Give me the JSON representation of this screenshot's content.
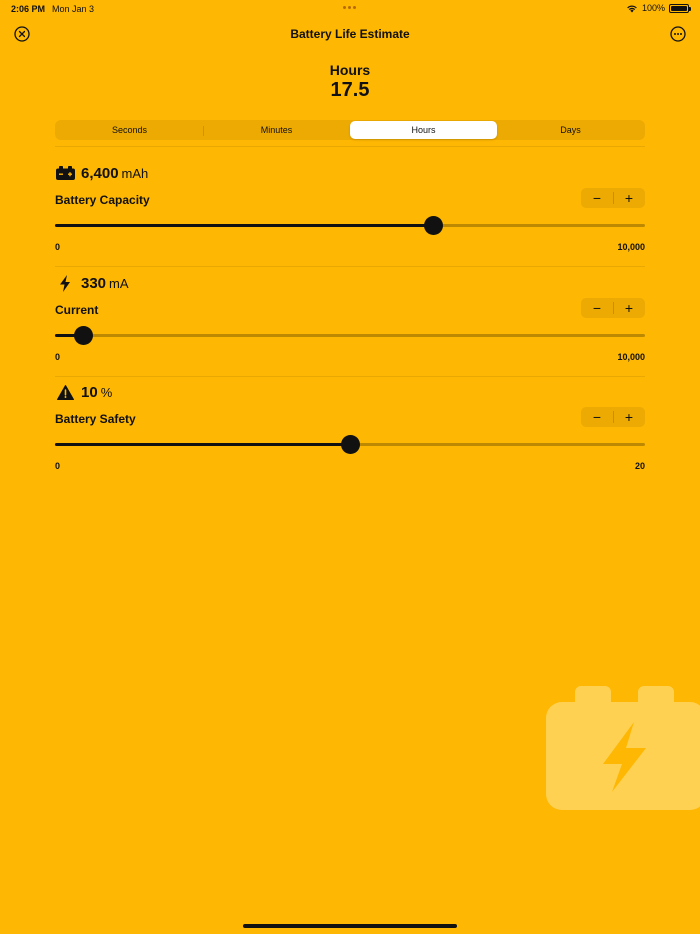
{
  "status_bar": {
    "time": "2:06 PM",
    "date": "Mon Jan 3",
    "battery_percent": "100%"
  },
  "nav": {
    "title": "Battery Life Estimate",
    "close_icon": "close-circle-icon",
    "more_icon": "ellipsis-circle-icon"
  },
  "result": {
    "label": "Hours",
    "value": "17.5"
  },
  "units_control": {
    "options": [
      "Seconds",
      "Minutes",
      "Hours",
      "Days"
    ],
    "selected": "Hours"
  },
  "sections": [
    {
      "icon": "battery-icon",
      "value": "6,400",
      "unit": "mAh",
      "label": "Battery Capacity",
      "min": "0",
      "max": "10,000",
      "fraction": 0.64,
      "decrement": "−",
      "increment": "+"
    },
    {
      "icon": "bolt-icon",
      "value": "330",
      "unit": "mA",
      "label": "Current",
      "min": "0",
      "max": "10,000",
      "fraction": 0.048,
      "decrement": "−",
      "increment": "+"
    },
    {
      "icon": "warning-icon",
      "value": "10",
      "unit": "%",
      "label": "Battery Safety",
      "min": "0",
      "max": "20",
      "fraction": 0.5,
      "decrement": "−",
      "increment": "+"
    }
  ],
  "colors": {
    "background": "#FEB703",
    "foreground": "#111111",
    "watermark": "#FFD152"
  }
}
